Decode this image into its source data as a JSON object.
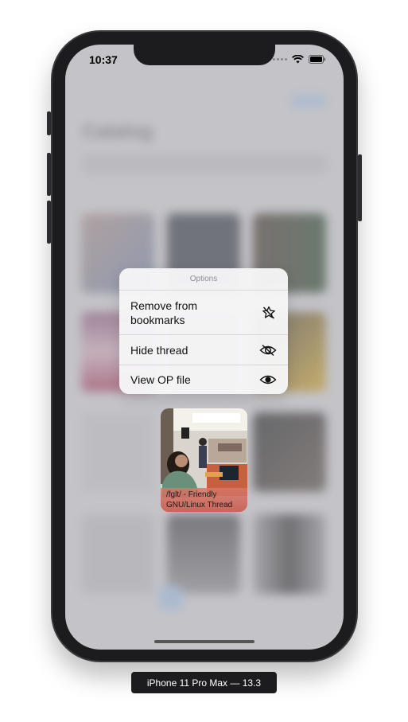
{
  "status_bar": {
    "time": "10:37"
  },
  "background": {
    "title": "Catalog"
  },
  "menu": {
    "header": "Options",
    "items": [
      {
        "label": "Remove from bookmarks",
        "icon": "star-slash-icon"
      },
      {
        "label": "Hide thread",
        "icon": "eye-slash-icon"
      },
      {
        "label": "View OP file",
        "icon": "eye-icon"
      }
    ]
  },
  "preview": {
    "caption": "/fglt/ - Friendly GNU/Linux Thread"
  },
  "device_label": "iPhone 11 Pro Max — 13.3",
  "colors": {
    "accent": "#9fb8d8",
    "caption_bg": "#d47a6a",
    "frame": "#1c1c1e"
  }
}
